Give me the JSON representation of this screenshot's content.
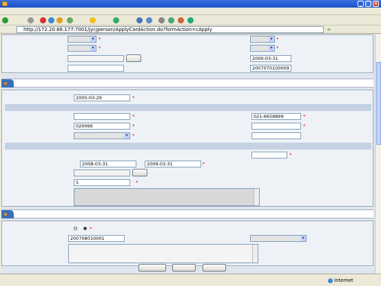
{
  "window": {
    "title": "",
    "min": "_",
    "max": "□",
    "close": "×"
  },
  "menu": [
    "",
    "",
    "",
    "",
    "",
    ""
  ],
  "toolbar": {
    "back": "",
    "search": "",
    "favorites": "",
    "media": ""
  },
  "address": {
    "label": "",
    "url": "http://172.20.66.177:7001/jycjperson/ApplyCardAction.do?formAction=cApply",
    "go": "",
    "links": ""
  },
  "form_top": {
    "lang1_label": "",
    "lang1_value": "",
    "prof1_label": "",
    "prof1_value": "",
    "lang2_label": "",
    "lang2_value": "",
    "prof2_label": "",
    "prof2_value": "",
    "tech_title_label": "",
    "tech_title_value": "",
    "choose": "",
    "issue_date_label": "",
    "issue_date_value": "2000-03-31",
    "cert_org_label": "",
    "cert_org_value": "",
    "cert_no_label": "",
    "cert_no_value": "2007070100009"
  },
  "work": {
    "section_title": "",
    "start_date_label": "",
    "start_date_value": "2005-03-29",
    "orig_band": "",
    "orig_unit_label": "",
    "orig_unit_value": "",
    "phone_label": "",
    "phone_value": "021-6658899",
    "postcode_label": "",
    "postcode_value": "020066",
    "orig_post_label": "",
    "orig_post_value": "",
    "orig_area_label": "",
    "orig_area_value": "",
    "orig_addr_label": "",
    "orig_addr_value": "",
    "hire_band": "",
    "unit_name_label": "",
    "unit_name_value": "",
    "cur_post_label": "",
    "cur_post_value": "",
    "hire_time_label": "",
    "from": "",
    "hire_from": "2008-03-31",
    "to": "",
    "hire_to": "2009-03-31",
    "major_label": "",
    "major_value": "",
    "years_label": "",
    "years_value": "5",
    "years_unit": "",
    "achieve_label": "",
    "achieve_value": "",
    "limit_note": ""
  },
  "expertise": {
    "section_title": "",
    "talent_label": "",
    "yes": "",
    "no": "",
    "cert_no_label": "",
    "cert_no_value": "200708010001",
    "cert_type_label": "",
    "cert_type_value": "",
    "specialty_label": "",
    "specialty_value": ""
  },
  "buttons": {
    "upload": "",
    "save": "",
    "back": ""
  },
  "status": {
    "zone": "Internet",
    "ime": ""
  }
}
